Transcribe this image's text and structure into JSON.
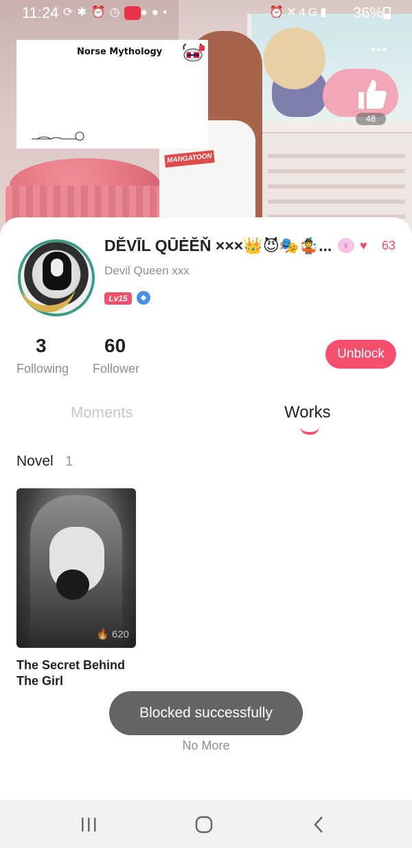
{
  "status_bar": {
    "time": "11:24",
    "battery": "36%",
    "network": "4G"
  },
  "banner": {
    "card_title": "Norse Mythology",
    "shirt_tag": "MANGATOON",
    "likes": "48"
  },
  "profile": {
    "display_name": "DĔVĪL QŪĖĔŇ ×××👑😈🎭🤹...",
    "username": "Devil Queen xxx",
    "level": "Lv15",
    "hearts_count": "63",
    "following_count": "3",
    "following_label": "Following",
    "follower_count": "60",
    "follower_label": "Follower",
    "action_button": "Unblock"
  },
  "tabs": [
    {
      "label": "Moments",
      "active": false
    },
    {
      "label": "Works",
      "active": true
    }
  ],
  "works": {
    "section_title": "Novel",
    "section_count": "1",
    "books": [
      {
        "title": "The Secret Behind The Girl",
        "views": "620"
      }
    ]
  },
  "toast": "Blocked successfully",
  "footer_text": "No More",
  "colors": {
    "accent": "#f64f6d",
    "toast_bg": "#646464",
    "muted_text": "#8e8e8e"
  },
  "icons": {
    "like": "thumbs-up-icon",
    "more": "more-dots-icon",
    "gender": "female-icon",
    "hearts": "hearts-icon",
    "views": "flame-icon",
    "nav_recent": "recent-apps-icon",
    "nav_home": "home-icon",
    "nav_back": "back-icon"
  }
}
